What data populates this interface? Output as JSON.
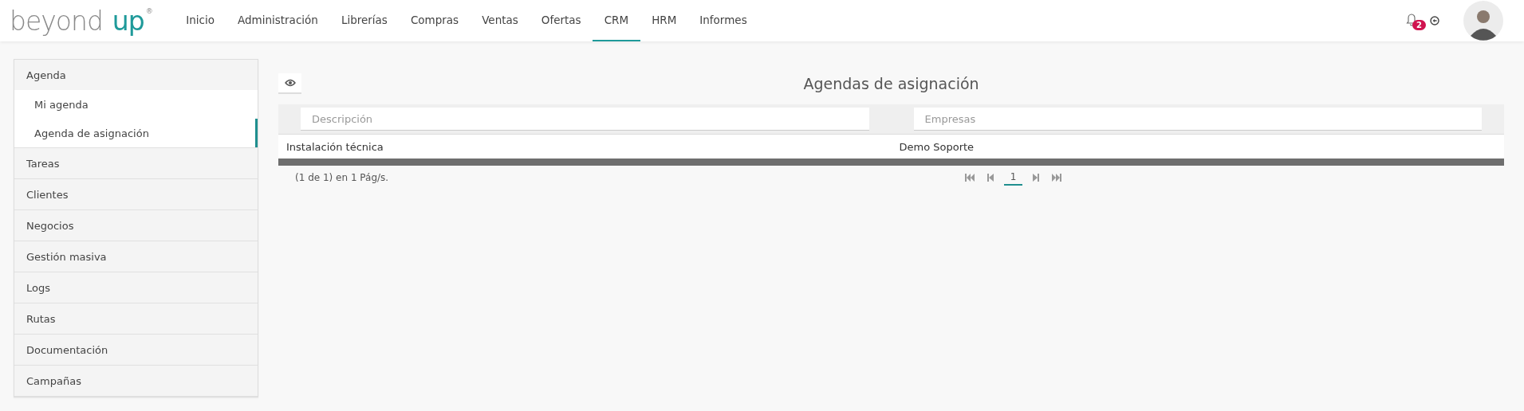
{
  "logo": {
    "word": "beyond",
    "accent": "up",
    "mark": "®"
  },
  "nav": [
    {
      "label": "Inicio",
      "selected": false
    },
    {
      "label": "Administración",
      "selected": false
    },
    {
      "label": "Librerías",
      "selected": false
    },
    {
      "label": "Compras",
      "selected": false
    },
    {
      "label": "Ventas",
      "selected": false
    },
    {
      "label": "Ofertas",
      "selected": false
    },
    {
      "label": "CRM",
      "selected": true
    },
    {
      "label": "HRM",
      "selected": false
    },
    {
      "label": "Informes",
      "selected": false
    }
  ],
  "notifications": {
    "count": "2"
  },
  "sidebar": [
    {
      "label": "Agenda",
      "expanded": true,
      "children": [
        {
          "label": "Mi agenda",
          "selected": false
        },
        {
          "label": "Agenda de asignación",
          "selected": true
        }
      ]
    },
    {
      "label": "Tareas",
      "expanded": false
    },
    {
      "label": "Clientes",
      "expanded": false
    },
    {
      "label": "Negocios",
      "expanded": false
    },
    {
      "label": "Gestión masiva",
      "expanded": false
    },
    {
      "label": "Logs",
      "expanded": false
    },
    {
      "label": "Rutas",
      "expanded": false
    },
    {
      "label": "Documentación",
      "expanded": false
    },
    {
      "label": "Campañas",
      "expanded": false
    }
  ],
  "page": {
    "title": "Agendas de asignación"
  },
  "table": {
    "filters": [
      {
        "placeholder": "Descripción"
      },
      {
        "placeholder": "Empresas"
      }
    ],
    "rows": [
      [
        "Instalación técnica",
        "Demo Soporte"
      ]
    ]
  },
  "pager": {
    "summary": "(1 de 1) en 1 Pág/s.",
    "pages": [
      {
        "label": "1",
        "selected": true
      }
    ]
  }
}
